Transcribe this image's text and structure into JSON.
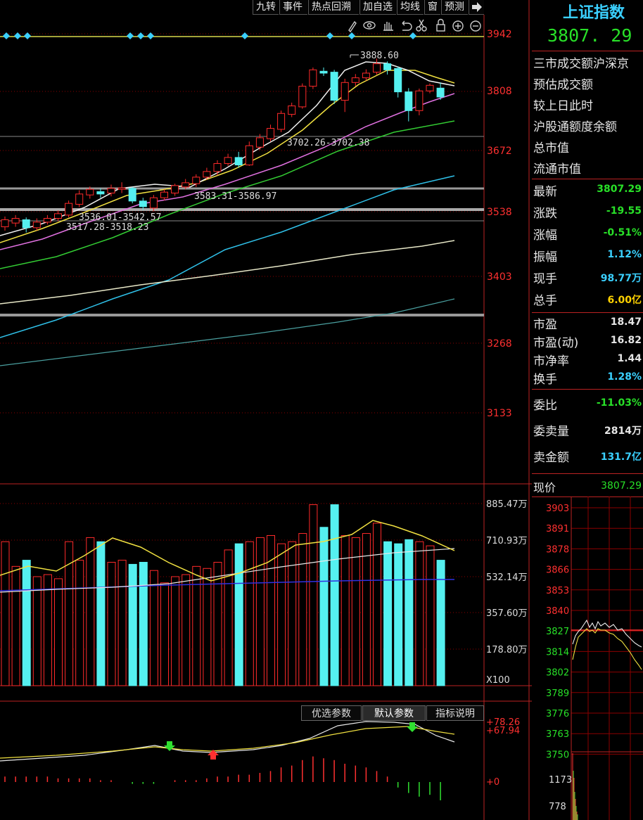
{
  "toolbar": {
    "buttons": [
      "九转",
      "事件",
      "热点回溯",
      "加自选",
      "均线",
      "窗",
      "预测"
    ],
    "exit_icon": "exit-arrow-icon"
  },
  "draw_tools": [
    "pen-icon",
    "eye-icon",
    "hand-icon",
    "undo-icon",
    "scissors-icon",
    "lock-icon",
    "zoom-in-icon",
    "zoom-out-icon"
  ],
  "index": {
    "name": "上证指数",
    "price": "3807. 29"
  },
  "info_rows": [
    "三市成交额沪深京",
    "预估成交额",
    "较上日此时",
    "沪股通额度余额",
    "总市值",
    "流通市值"
  ],
  "quote": [
    {
      "label": "最新",
      "value": "3807.29",
      "color": "#28e028"
    },
    {
      "label": "涨跌",
      "value": "-19.55",
      "color": "#28e028"
    },
    {
      "label": "涨幅",
      "value": "-0.51%",
      "color": "#28e028"
    },
    {
      "label": "振幅",
      "value": "1.12%",
      "color": "#3ad0ff"
    },
    {
      "label": "现手",
      "value": "98.77万",
      "color": "#3ad0ff"
    },
    {
      "label": "总手",
      "value": "6.00亿",
      "color": "#ffd200"
    }
  ],
  "valuation": [
    {
      "label": "市盈",
      "value": "18.47",
      "color": "#e6e6e6"
    },
    {
      "label": "市盈(动)",
      "value": "16.82",
      "color": "#e6e6e6"
    },
    {
      "label": "市净率",
      "value": "1.44",
      "color": "#e6e6e6"
    },
    {
      "label": "换手",
      "value": "1.28%",
      "color": "#3ad0ff"
    }
  ],
  "orders": [
    {
      "label": "委比",
      "value": "-11.03%",
      "color": "#28e028"
    },
    {
      "label": "委卖量",
      "value": "2814万",
      "color": "#e6e6e6"
    },
    {
      "label": "卖金额",
      "value": "131.7亿",
      "color": "#3ad0ff"
    }
  ],
  "current": {
    "label": "现价",
    "value": "3807.29"
  },
  "mini_axis": [
    "3903",
    "3891",
    "3878",
    "3866",
    "3853",
    "3840",
    "3827",
    "3814",
    "3802",
    "3789",
    "3776",
    "3763",
    "3750"
  ],
  "mini_vol_axis": [
    "1173",
    "778"
  ],
  "price_axis": [
    "3942",
    "3808",
    "3672",
    "3538",
    "3403",
    "3268",
    "3133"
  ],
  "volume_axis": [
    "885.47万",
    "710.93万",
    "532.14万",
    "357.60万",
    "178.80万"
  ],
  "volume_multiplier": "X100",
  "macd_axis": [
    "+78.26",
    "+67.94",
    "+0"
  ],
  "indicator_buttons": [
    "优选参数",
    "默认参数",
    "指标说明"
  ],
  "annotations": {
    "high": "3888.60",
    "gap1": "3702.26-3702.38",
    "gap2": "3583.31-3586.97",
    "gap3": "3536.01-3542.57",
    "gap4": "3517.28-3518.23"
  },
  "colors": {
    "up": "#ff2a2a",
    "down": "#55f0f0",
    "axis": "#ff3030",
    "grid": "#8b0000"
  },
  "chart_data": {
    "type": "candlestick",
    "y_range": [
      3133,
      3942
    ],
    "candles": [
      {
        "o": 3530,
        "c": 3545,
        "h": 3552,
        "l": 3522
      },
      {
        "o": 3538,
        "c": 3548,
        "h": 3555,
        "l": 3530
      },
      {
        "o": 3545,
        "c": 3528,
        "h": 3550,
        "l": 3518
      },
      {
        "o": 3528,
        "c": 3540,
        "h": 3548,
        "l": 3522
      },
      {
        "o": 3540,
        "c": 3548,
        "h": 3555,
        "l": 3535
      },
      {
        "o": 3548,
        "c": 3558,
        "h": 3565,
        "l": 3542
      },
      {
        "o": 3555,
        "c": 3580,
        "h": 3586,
        "l": 3550
      },
      {
        "o": 3578,
        "c": 3600,
        "h": 3608,
        "l": 3572
      },
      {
        "o": 3598,
        "c": 3610,
        "h": 3616,
        "l": 3590
      },
      {
        "o": 3605,
        "c": 3600,
        "h": 3612,
        "l": 3592
      },
      {
        "o": 3602,
        "c": 3612,
        "h": 3620,
        "l": 3595
      },
      {
        "o": 3610,
        "c": 3613,
        "h": 3625,
        "l": 3602
      },
      {
        "o": 3612,
        "c": 3585,
        "h": 3615,
        "l": 3580
      },
      {
        "o": 3585,
        "c": 3573,
        "h": 3592,
        "l": 3566
      },
      {
        "o": 3570,
        "c": 3592,
        "h": 3598,
        "l": 3563
      },
      {
        "o": 3592,
        "c": 3604,
        "h": 3610,
        "l": 3586
      },
      {
        "o": 3602,
        "c": 3618,
        "h": 3622,
        "l": 3596
      },
      {
        "o": 3615,
        "c": 3624,
        "h": 3632,
        "l": 3610
      },
      {
        "o": 3622,
        "c": 3636,
        "h": 3642,
        "l": 3615
      },
      {
        "o": 3636,
        "c": 3648,
        "h": 3656,
        "l": 3630
      },
      {
        "o": 3648,
        "c": 3665,
        "h": 3672,
        "l": 3640
      },
      {
        "o": 3665,
        "c": 3678,
        "h": 3686,
        "l": 3660
      },
      {
        "o": 3678,
        "c": 3662,
        "h": 3690,
        "l": 3656
      },
      {
        "o": 3662,
        "c": 3703,
        "h": 3712,
        "l": 3660
      },
      {
        "o": 3700,
        "c": 3720,
        "h": 3728,
        "l": 3694
      },
      {
        "o": 3718,
        "c": 3740,
        "h": 3748,
        "l": 3712
      },
      {
        "o": 3738,
        "c": 3772,
        "h": 3778,
        "l": 3732
      },
      {
        "o": 3770,
        "c": 3788,
        "h": 3795,
        "l": 3764
      },
      {
        "o": 3786,
        "c": 3830,
        "h": 3836,
        "l": 3782
      },
      {
        "o": 3830,
        "c": 3865,
        "h": 3870,
        "l": 3824
      },
      {
        "o": 3862,
        "c": 3858,
        "h": 3870,
        "l": 3852
      },
      {
        "o": 3860,
        "c": 3800,
        "h": 3865,
        "l": 3792
      },
      {
        "o": 3800,
        "c": 3838,
        "h": 3846,
        "l": 3775
      },
      {
        "o": 3838,
        "c": 3848,
        "h": 3856,
        "l": 3830
      },
      {
        "o": 3848,
        "c": 3858,
        "h": 3866,
        "l": 3842
      },
      {
        "o": 3860,
        "c": 3878,
        "h": 3889,
        "l": 3855
      },
      {
        "o": 3878,
        "c": 3865,
        "h": 3883,
        "l": 3855
      },
      {
        "o": 3868,
        "c": 3818,
        "h": 3872,
        "l": 3806
      },
      {
        "o": 3818,
        "c": 3778,
        "h": 3826,
        "l": 3755
      },
      {
        "o": 3778,
        "c": 3820,
        "h": 3825,
        "l": 3768
      },
      {
        "o": 3820,
        "c": 3832,
        "h": 3836,
        "l": 3815
      },
      {
        "o": 3826,
        "c": 3807,
        "h": 3838,
        "l": 3801
      }
    ],
    "volume": [
      700,
      580,
      610,
      530,
      540,
      520,
      700,
      610,
      720,
      700,
      600,
      610,
      590,
      600,
      560,
      500,
      530,
      540,
      580,
      570,
      600,
      660,
      690,
      700,
      720,
      730,
      690,
      700,
      740,
      880,
      770,
      880,
      730,
      720,
      740,
      790,
      700,
      690,
      710,
      700,
      680,
      610
    ],
    "volume_range": [
      0,
      885.47
    ],
    "macd_hist": [
      3,
      3,
      3,
      3,
      3,
      2,
      2,
      2,
      2,
      1,
      1,
      0,
      -1,
      -1,
      -1,
      0,
      1,
      1,
      1,
      2,
      3,
      3,
      4,
      4,
      5,
      6,
      8,
      9,
      12,
      14,
      13,
      12,
      10,
      9,
      8,
      6,
      3,
      -3,
      -6,
      -8,
      -7,
      -10
    ]
  }
}
